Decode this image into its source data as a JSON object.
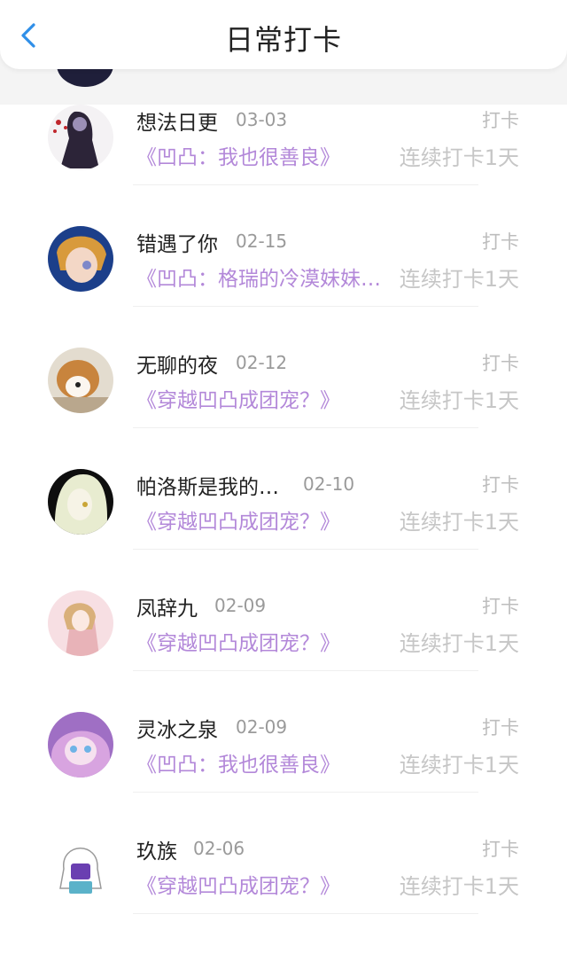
{
  "header": {
    "title": "日常打卡",
    "back_icon": "chevron-left-icon",
    "accent": "#2f8fe8"
  },
  "colors": {
    "book_title": "#b388d9",
    "muted": "#bdbdbd"
  },
  "checkins": [
    {
      "name": "想法日更",
      "date": "03-03",
      "action": "打卡",
      "book": "《凹凸：我也很善良》",
      "streak": "连续打卡1天",
      "avatar_colors": [
        "#f4f2f4",
        "#2c2438",
        "#9b8fb6"
      ]
    },
    {
      "name": "错遇了你",
      "date": "02-15",
      "action": "打卡",
      "book": "《凹凸：格瑞的冷漠妹妹…",
      "streak": "连续打卡1天",
      "avatar_colors": [
        "#1c3f8a",
        "#d89a3c",
        "#7e88c9"
      ]
    },
    {
      "name": "无聊的夜",
      "date": "02-12",
      "action": "打卡",
      "book": "《穿越凹凸成团宠？》",
      "streak": "连续打卡1天",
      "avatar_colors": [
        "#e3dccf",
        "#c8843d",
        "#fbf6ef"
      ]
    },
    {
      "name": "帕洛斯是我的…",
      "date": "02-10",
      "action": "打卡",
      "book": "《穿越凹凸成团宠？》",
      "streak": "连续打卡1天",
      "avatar_colors": [
        "#0e0e0e",
        "#e8ecd0",
        "#c9cba8"
      ]
    },
    {
      "name": "凤辞九",
      "date": "02-09",
      "action": "打卡",
      "book": "《穿越凹凸成团宠？》",
      "streak": "连续打卡1天",
      "avatar_colors": [
        "#f7dfe3",
        "#e8b3b8",
        "#d9b07a"
      ]
    },
    {
      "name": "灵冰之泉",
      "date": "02-09",
      "action": "打卡",
      "book": "《凹凸：我也很善良》",
      "streak": "连续打卡1天",
      "avatar_colors": [
        "#9f6fc4",
        "#d8a4e0",
        "#6fb3e6"
      ]
    },
    {
      "name": "玖族",
      "date": "02-06",
      "action": "打卡",
      "book": "《穿越凹凸成团宠？》",
      "streak": "连续打卡1天",
      "avatar_colors": [
        "#ffffff",
        "#6a3fb1",
        "#5bb2c9"
      ]
    }
  ]
}
